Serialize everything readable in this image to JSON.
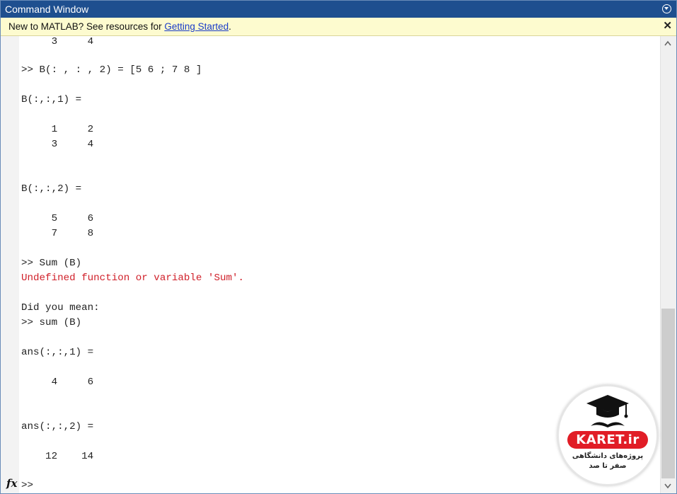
{
  "window": {
    "title": "Command Window",
    "title_menu_icon": "circle-chevron-down-icon"
  },
  "banner": {
    "text": "New to MATLAB? See resources for ",
    "link_text": "Getting Started",
    "suffix": ".",
    "close_icon": "close-x-icon"
  },
  "console": {
    "lines": [
      {
        "text": "     3     4"
      },
      {
        "text": ">> B(: , : , 2) = [5 6 ; 7 8 ]"
      },
      {
        "text": "B(:,:,1) ="
      },
      {
        "text": "     1     2"
      },
      {
        "text": "     3     4"
      },
      {
        "text": "B(:,:,2) ="
      },
      {
        "text": "     5     6"
      },
      {
        "text": "     7     8"
      },
      {
        "text": ">> Sum (B)"
      },
      {
        "text": "Undefined function or variable 'Sum'.",
        "error": true
      },
      {
        "text": "Did you mean:"
      },
      {
        "text": ">> sum (B)"
      },
      {
        "text": "ans(:,:,1) ="
      },
      {
        "text": "     4     6"
      },
      {
        "text": "ans(:,:,2) ="
      },
      {
        "text": "    12    14"
      },
      {
        "text": ">>"
      }
    ]
  },
  "prompt_icon": "fx-function-icon",
  "colors": {
    "titlebar": "#1e4f8f",
    "banner_bg": "#fdfbcf",
    "error_text": "#d0202a"
  },
  "watermark": {
    "brand": "KARET.ir",
    "tagline_1": "پروژه‌های دانشگاهی",
    "tagline_2": "صفر تا صد",
    "icon": "graduation-cap-mustache-icon"
  }
}
